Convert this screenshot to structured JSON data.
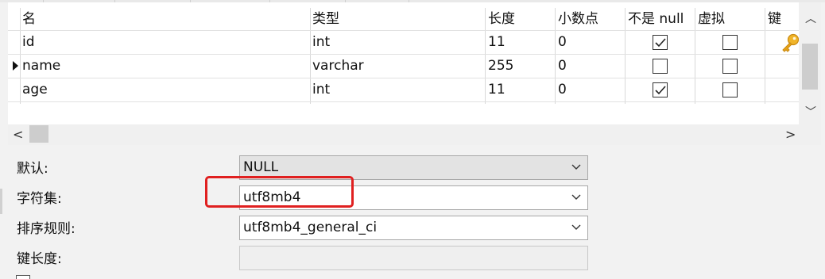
{
  "table": {
    "headers": [
      "名",
      "类型",
      "长度",
      "小数点",
      "不是 null",
      "虚拟",
      "键"
    ],
    "rows": [
      {
        "name": "id",
        "type": "int",
        "length": "11",
        "decimals": "0",
        "not_null": true,
        "virtual": false,
        "key": true,
        "selected": false
      },
      {
        "name": "name",
        "type": "varchar",
        "length": "255",
        "decimals": "0",
        "not_null": false,
        "virtual": false,
        "key": false,
        "selected": true
      },
      {
        "name": "age",
        "type": "int",
        "length": "11",
        "decimals": "0",
        "not_null": true,
        "virtual": false,
        "key": false,
        "selected": false
      }
    ]
  },
  "scrollbars": {
    "up_arrow": "︿",
    "down_arrow": "﹀",
    "left_arrow": "<",
    "right_arrow": ">"
  },
  "properties": {
    "default_label": "默认:",
    "default_value": "NULL",
    "charset_label": "字符集:",
    "charset_value": "utf8mb4",
    "collation_label": "排序规则:",
    "collation_value": "utf8mb4_general_ci",
    "key_length_label": "键长度:",
    "key_length_value": ""
  },
  "colors": {
    "highlight": "#e02020",
    "key_icon": "#e8a317"
  }
}
